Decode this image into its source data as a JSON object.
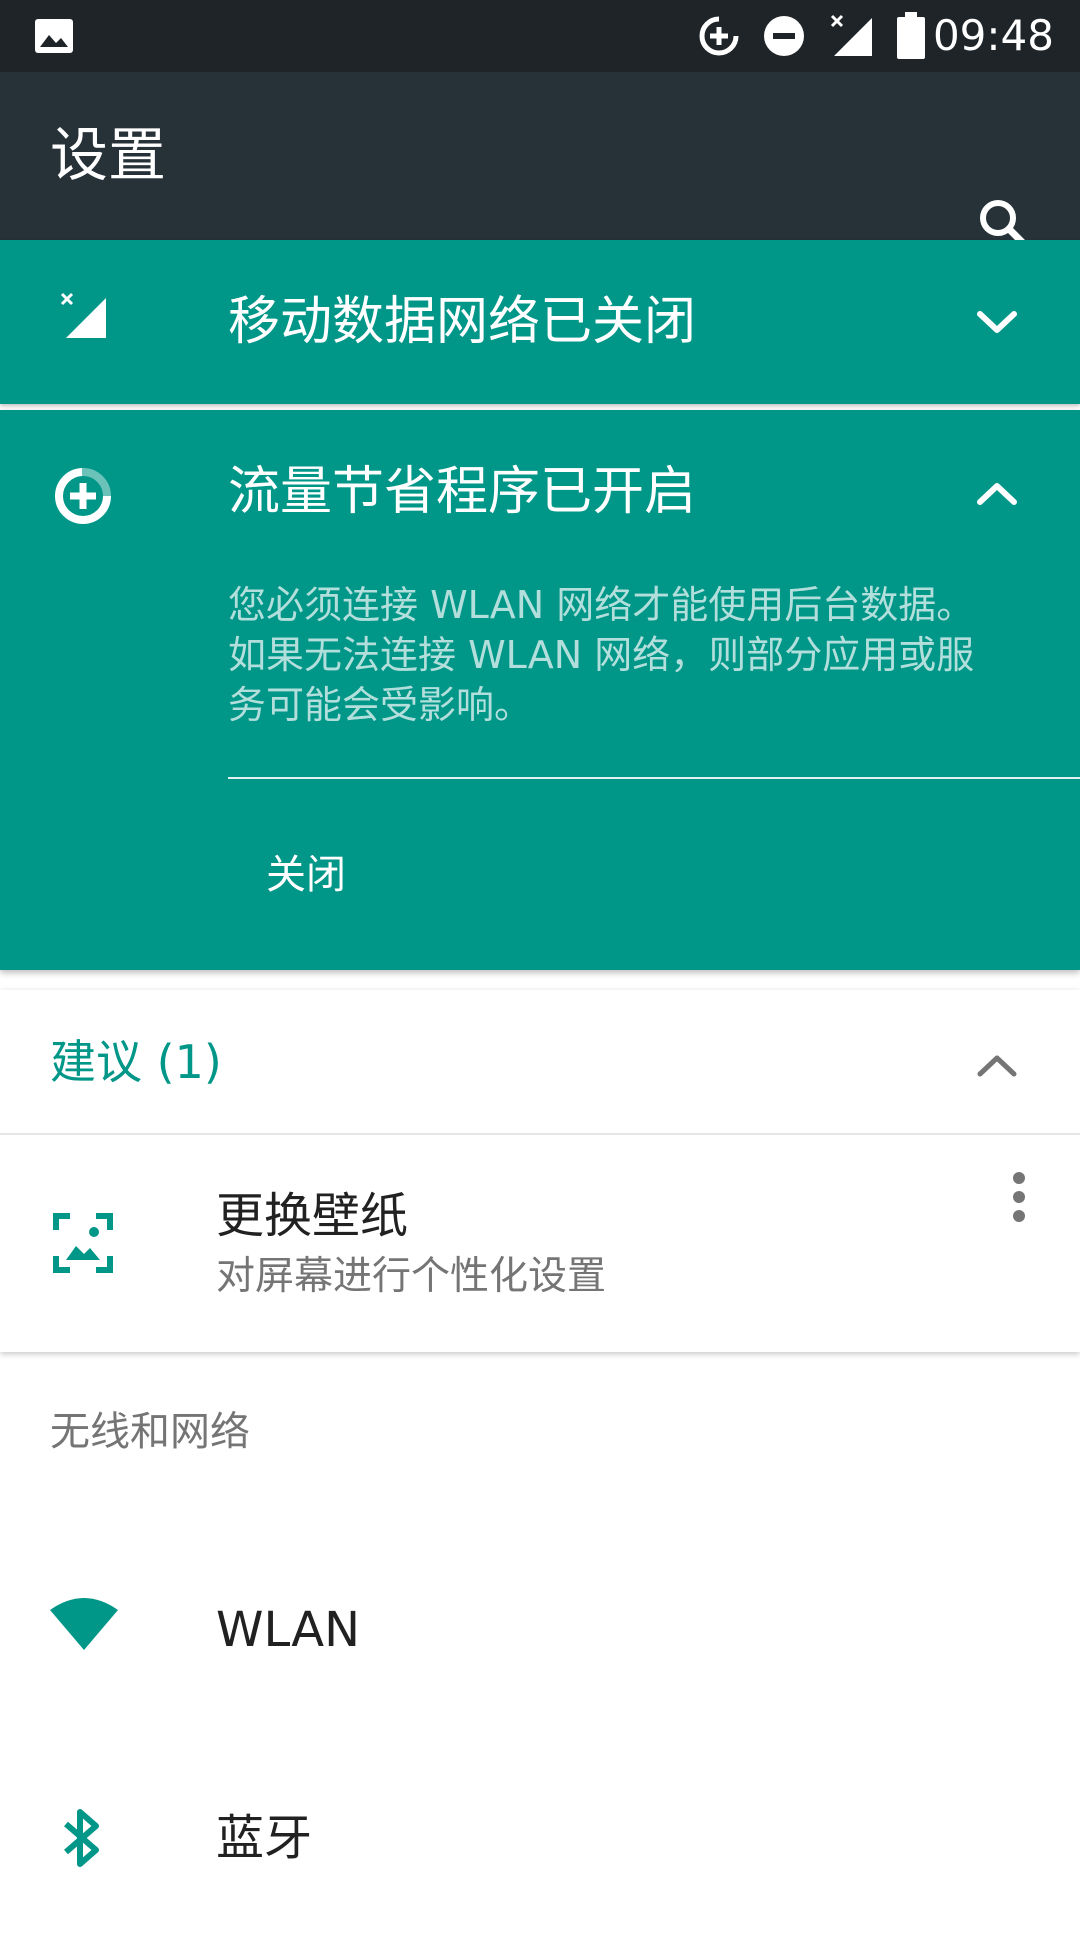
{
  "status_bar": {
    "time": "09:48",
    "icons": [
      "image-notification-icon",
      "data-saver-icon",
      "do-not-disturb-icon",
      "no-signal-icon",
      "battery-icon"
    ]
  },
  "toolbar": {
    "title": "设置",
    "search_icon": "search-icon"
  },
  "banners": {
    "mobile_data": {
      "title": "移动数据网络已关闭",
      "icon": "mobile-data-off-icon",
      "state": "collapsed"
    },
    "data_saver": {
      "title": "流量节省程序已开启",
      "icon": "data-saver-icon",
      "state": "expanded",
      "body": "您必须连接 WLAN 网络才能使用后台数据。如果无法连接 WLAN 网络，则部分应用或服务可能会受影响。",
      "action_label": "关闭"
    }
  },
  "suggestions": {
    "header": "建议 (1)",
    "items": [
      {
        "title": "更换壁纸",
        "subtitle": "对屏幕进行个性化设置",
        "icon": "wallpaper-icon"
      }
    ]
  },
  "wireless_section": {
    "header": "无线和网络",
    "items": [
      {
        "label": "WLAN",
        "icon": "wifi-icon"
      },
      {
        "label": "蓝牙",
        "icon": "bluetooth-icon"
      }
    ]
  },
  "colors": {
    "accent": "#009688",
    "toolbar": "#263238",
    "status_bar": "#1e2428"
  }
}
